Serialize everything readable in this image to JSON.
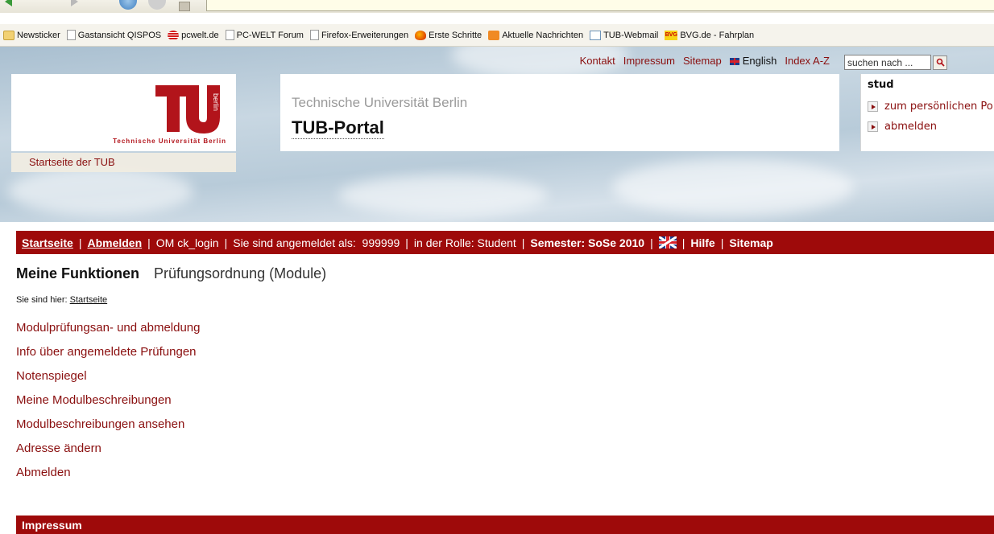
{
  "bookmarks": [
    {
      "label": "Newsticker",
      "icon": "folder-icon"
    },
    {
      "label": "Gastansicht QISPOS",
      "icon": "page-icon"
    },
    {
      "label": "pcwelt.de",
      "icon": "pcwelt-icon"
    },
    {
      "label": "PC-WELT Forum",
      "icon": "page-icon"
    },
    {
      "label": "Firefox-Erweiterungen",
      "icon": "page-icon"
    },
    {
      "label": "Erste Schritte",
      "icon": "firefox-icon"
    },
    {
      "label": "Aktuelle Nachrichten",
      "icon": "rss-icon"
    },
    {
      "label": "TUB-Webmail",
      "icon": "mail-icon"
    },
    {
      "label": "BVG.de - Fahrplan",
      "icon": "bvg-icon",
      "icon_text": "BVG"
    }
  ],
  "header": {
    "logo_text": "Technische Universität Berlin",
    "startseite_prefix": "Startseite der ",
    "startseite_link": "TUB",
    "top_links": {
      "kontakt": "Kontakt",
      "impressum": "Impressum",
      "sitemap": "Sitemap",
      "english": "English",
      "index": "Index A-Z"
    },
    "search": {
      "value": "suchen nach ..."
    },
    "university": "Technische Universität Berlin",
    "portal": "TUB-Portal",
    "user": {
      "name": "stud",
      "link_profile": "zum persönlichen Po",
      "link_logout": "abmelden"
    }
  },
  "navbar": {
    "startseite": "Startseite",
    "abmelden": "Abmelden",
    "om": "OM ck_login",
    "logged_in": "Sie sind angemeldet als:  999999",
    "role": "in der Rolle: Student",
    "semester": "Semester: SoSe 2010",
    "hilfe": "Hilfe",
    "sitemap": "Sitemap",
    "separator": "|"
  },
  "content": {
    "tab_active": "Meine Funktionen",
    "tab_other": "Prüfungsordnung (Module)",
    "breadcrumb_prefix": "Sie sind hier: ",
    "breadcrumb_link": "Startseite",
    "functions": [
      "Modulprüfungsan- und abmeldung",
      "Info über angemeldete Prüfungen",
      "Notenspiegel",
      "Meine Modulbeschreibungen",
      "Modulbeschreibungen ansehen",
      "Adresse ändern",
      "Abmelden"
    ]
  },
  "footer": {
    "label": "Impressum"
  },
  "colors": {
    "brand_red": "#9e0a0a",
    "link_red": "#8a0f0f",
    "logo_red": "#b2141b"
  }
}
